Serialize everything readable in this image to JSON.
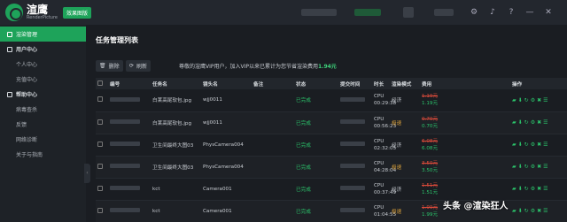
{
  "header": {
    "logo_name": "渲鹰",
    "logo_sub": "RenderPicture",
    "version_badge": "效果图版"
  },
  "sidebar": {
    "items": [
      {
        "label": "渲染管理",
        "type": "active"
      },
      {
        "label": "用户中心",
        "type": "group"
      },
      {
        "label": "个人中心",
        "type": "sub"
      },
      {
        "label": "充值中心",
        "type": "sub"
      },
      {
        "label": "帮助中心",
        "type": "group"
      },
      {
        "label": "病毒查杀",
        "type": "sub"
      },
      {
        "label": "反馈",
        "type": "sub"
      },
      {
        "label": "网络诊断",
        "type": "sub"
      },
      {
        "label": "关于与指南",
        "type": "sub"
      }
    ]
  },
  "main": {
    "title": "任务管理列表",
    "delete_label": "删除",
    "refresh_label": "刷新",
    "notice_prefix": "尊敬的渲鹰VIP用户，加入VIP以来已累计为您节省渲染费用",
    "notice_amount": "1.94元"
  },
  "table": {
    "headers": [
      "",
      "编号",
      "任务名",
      "镜头名",
      "备注",
      "状态",
      "提交时间",
      "时长",
      "渲染模式",
      "费用",
      "",
      "操作"
    ],
    "rows": [
      {
        "task": "白莱高尾软包.jpg",
        "camera": "wjj0011",
        "status": "已完成",
        "cpu": "CPU",
        "time": "00:29:38",
        "mode": "经济",
        "old": "1.19元",
        "new": "1.19元"
      },
      {
        "task": "白莱高尾软包.jpg",
        "camera": "wjj0011",
        "status": "已完成",
        "cpu": "CPU",
        "time": "00:56:23",
        "mode": "极速",
        "old": "0.70元",
        "new": "0.70元"
      },
      {
        "task": "卫生间最终大图03",
        "camera": "PhysCamera004",
        "status": "已完成",
        "cpu": "CPU",
        "time": "02:32:05",
        "mode": "经济",
        "old": "6.08元",
        "new": "6.08元"
      },
      {
        "task": "卫生间最终大图03",
        "camera": "PhysCamera004",
        "status": "已完成",
        "cpu": "CPU",
        "time": "04:28:04",
        "mode": "极速",
        "old": "3.50元",
        "new": "3.50元"
      },
      {
        "task": "kct",
        "camera": "Camera001",
        "status": "已完成",
        "cpu": "CPU",
        "time": "00:37:49",
        "mode": "经济",
        "old": "1.51元",
        "new": "1.51元"
      },
      {
        "task": "kct",
        "camera": "Camera001",
        "status": "已完成",
        "cpu": "CPU",
        "time": "01:04:55",
        "mode": "极速",
        "old": "1.99元",
        "new": "1.99元"
      }
    ]
  },
  "watermark": "头条 @渲染狂人",
  "colors": {
    "accent": "#1ea35a",
    "price_old": "#d94a3a",
    "price_new": "#2bc46b"
  }
}
